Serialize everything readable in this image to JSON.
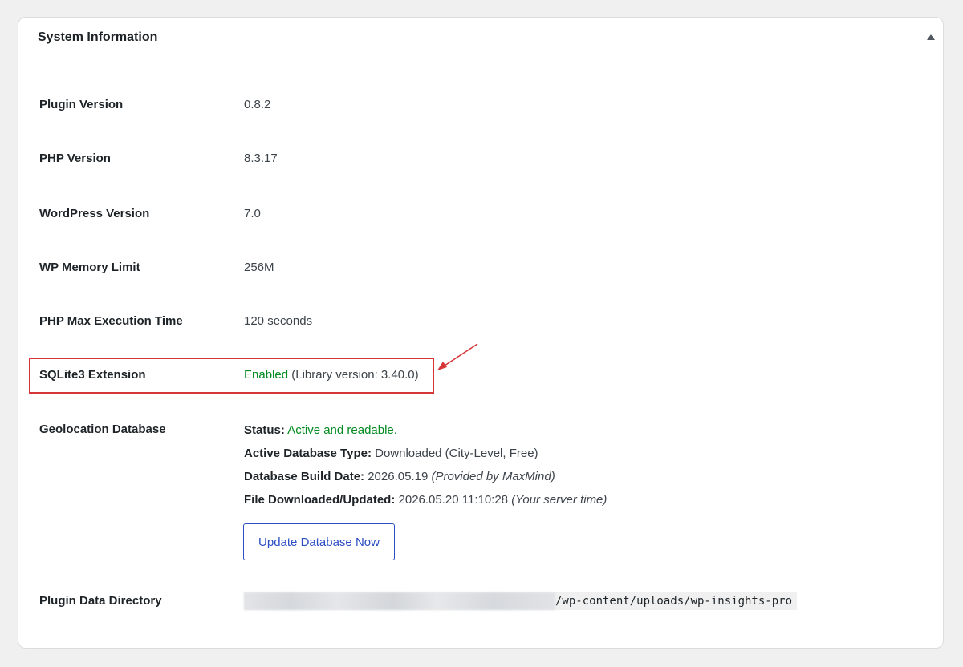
{
  "panel": {
    "title": "System Information"
  },
  "rows": [
    {
      "label": "Plugin Version",
      "value": "0.8.2"
    },
    {
      "label": "PHP Version",
      "value": "8.3.17"
    },
    {
      "label": "WordPress Version",
      "value": "7.0"
    },
    {
      "label": "WP Memory Limit",
      "value": "256M"
    },
    {
      "label": "PHP Max Execution Time",
      "value": "120 seconds"
    }
  ],
  "sqlite": {
    "label": "SQLite3 Extension",
    "status": "Enabled",
    "detail": " (Library version: 3.40.0)"
  },
  "geo": {
    "label": "Geolocation Database",
    "status_label": "Status:",
    "status_value": " Active and readable.",
    "type_label": "Active Database Type:",
    "type_value": " Downloaded (City-Level, Free)",
    "build_label": "Database Build Date:",
    "build_value": " 2026.05.19 ",
    "build_note": "(Provided by MaxMind)",
    "file_label": "File Downloaded/Updated:",
    "file_value": " 2026.05.20 11:10:28 ",
    "file_note": "(Your server time)",
    "button_label": "Update Database Now"
  },
  "data_dir": {
    "label": "Plugin Data Directory",
    "path": "/wp-content/uploads/wp-insights-pro"
  },
  "colors": {
    "status_green": "#008a20",
    "highlight_red": "#d63638",
    "button_blue": "#2c4dc4"
  }
}
